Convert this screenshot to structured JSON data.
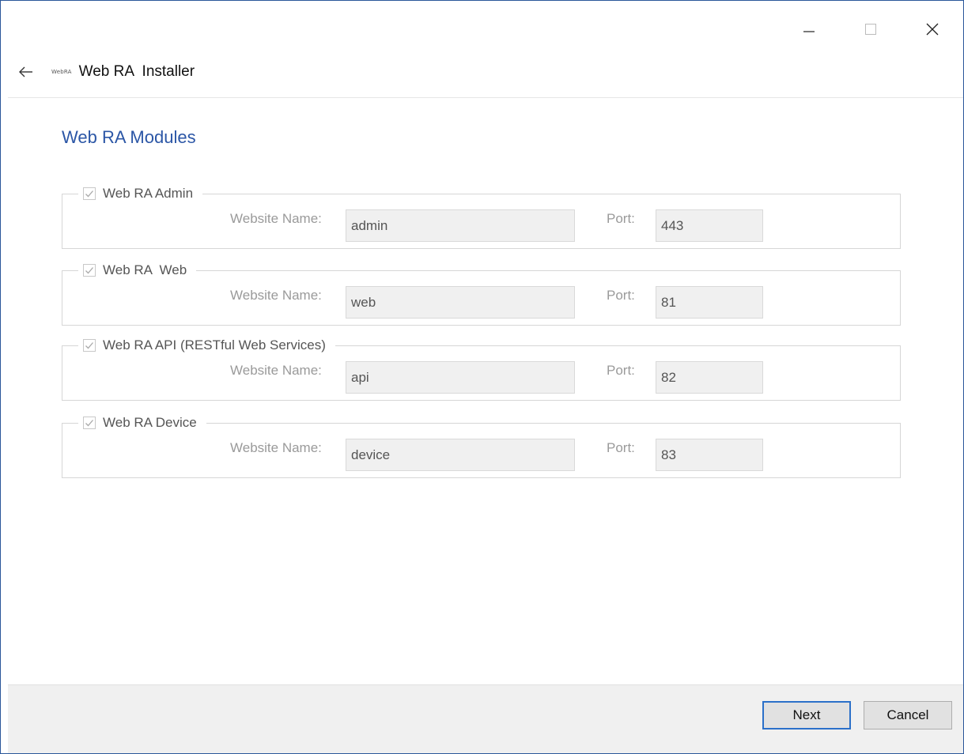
{
  "window": {
    "controls": [
      "minimize",
      "maximize",
      "close"
    ]
  },
  "titlebar": {
    "logo_text": "WebRA",
    "title": "Web RA  Installer"
  },
  "page": {
    "heading": "Web RA Modules"
  },
  "modules": [
    {
      "label": "Web RA Admin",
      "checked": true,
      "name_label": "Website Name:",
      "name_value": "admin",
      "port_label": "Port:",
      "port_value": "443"
    },
    {
      "label": "Web RA  Web",
      "checked": true,
      "name_label": "Website Name:",
      "name_value": "web",
      "port_label": "Port:",
      "port_value": "81"
    },
    {
      "label": "Web RA API (RESTful Web Services)",
      "checked": true,
      "name_label": "Website Name:",
      "name_value": "api",
      "port_label": "Port:",
      "port_value": "82"
    },
    {
      "label": "Web RA Device",
      "checked": true,
      "name_label": "Website Name:",
      "name_value": "device",
      "port_label": "Port:",
      "port_value": "83"
    }
  ],
  "footer": {
    "next_label": "Next",
    "cancel_label": "Cancel"
  },
  "colors": {
    "heading": "#2b56a6",
    "window_border": "#2b579a",
    "default_button_border": "#2b70c9"
  }
}
